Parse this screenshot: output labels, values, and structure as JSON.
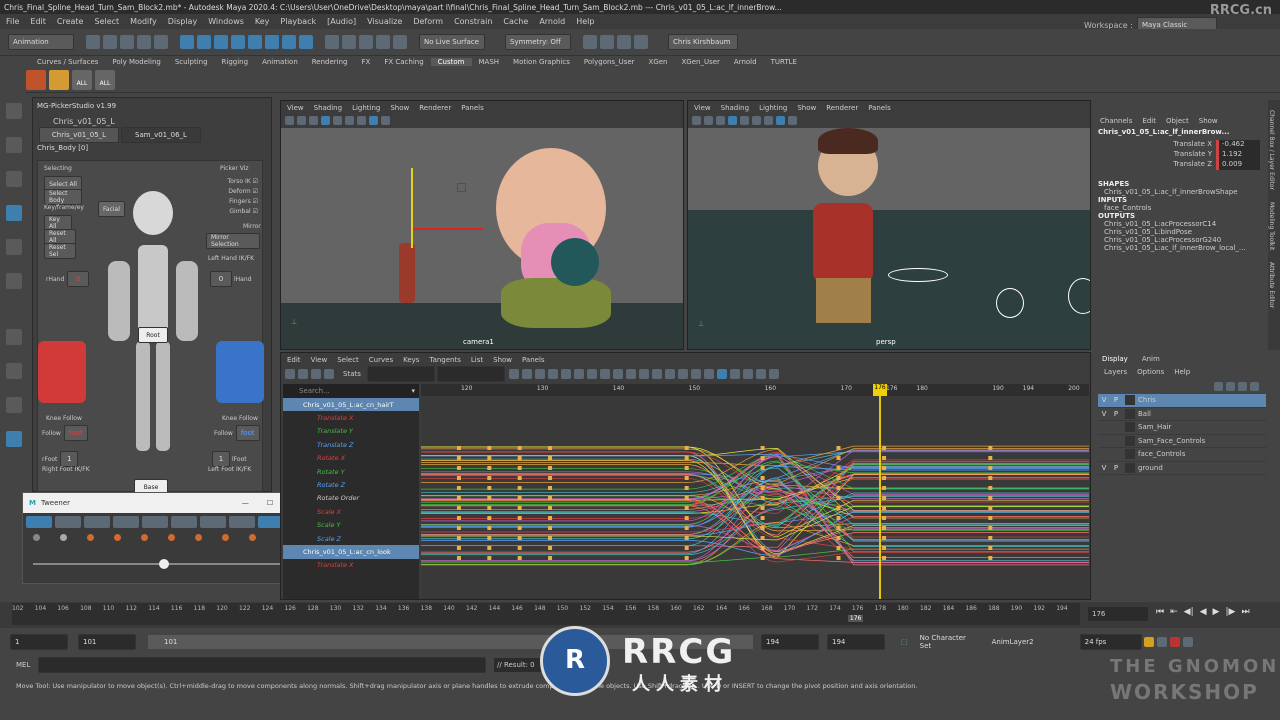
{
  "title_bar": "Chris_Final_Spline_Head_Turn_Sam_Block2.mb* - Autodesk Maya 2020.4: C:\\Users\\User\\OneDrive\\Desktop\\maya\\part I\\final\\Chris_Final_Spline_Head_Turn_Sam_Block2.mb  ---  Chris_v01_05_L:ac_lf_innerBrow...",
  "menu": [
    "File",
    "Edit",
    "Create",
    "Select",
    "Modify",
    "Display",
    "Windows",
    "Key",
    "Playback",
    "[Audio]",
    "Visualize",
    "Deform",
    "Constrain",
    "Cache",
    "Arnold",
    "Help"
  ],
  "workspace_label": "Workspace :",
  "workspace_value": "Maya Classic",
  "menuset": "Animation",
  "no_live_surface": "No Live Surface",
  "symmetry": "Symmetry: Off",
  "user": "Chris Kirshbaum",
  "shelf_tabs": [
    "Curves / Surfaces",
    "Poly Modeling",
    "Sculpting",
    "Rigging",
    "Animation",
    "Rendering",
    "FX",
    "FX Caching",
    "Custom",
    "MASH",
    "Motion Graphics",
    "Polygons_User",
    "XGen",
    "XGen_User",
    "Arnold",
    "TURTLE"
  ],
  "shelf_active": "Custom",
  "shelf_icons": [
    "ALL",
    "ALL"
  ],
  "picker": {
    "title": "MG-PickerStudio v1.99",
    "char_dropdown": "Chris_v01_05_L",
    "tab1": "Chris_v01_05_L",
    "tab2": "Sam_v01_06_L",
    "sub": "Chris_Body [0]",
    "selecting": "Selecting",
    "select_all": "Select All",
    "select_body": "Select Body",
    "keyframe": "Key/frame/ey",
    "key_all": "Key All",
    "reset_all": "Reset All",
    "reset_sel": "Reset Sel",
    "picker_viz": "Picker Viz",
    "torso": "Torso IK",
    "deform": "Deform",
    "fingers": "Fingers",
    "gimbal": "Gimbal",
    "mirror": "Mirror",
    "mirror_selection": "Mirror Selection",
    "facial": "Facial",
    "root": "Root",
    "lhand": "Left Hand IK/FK",
    "rhand": "rHand",
    "hand_val": "0",
    "lhand_lbl": "lHand",
    "knee_follow_l": "Knee Follow",
    "knee_follow_r": "Knee Follow",
    "follow": "Follow",
    "foot": "foot",
    "rfoot": "rFoot",
    "lfoot": "lFoot",
    "rfoot_lbl": "Right Foot IK/FK",
    "lfoot_lbl": "Left Foot IK/FK",
    "one": "1",
    "base": "Base"
  },
  "tweener": {
    "title": "Tweener"
  },
  "viewport_menu": [
    "View",
    "Shading",
    "Lighting",
    "Show",
    "Renderer",
    "Panels"
  ],
  "cam1": "camera1",
  "cam2": "persp",
  "graph": {
    "menu": [
      "Edit",
      "View",
      "Select",
      "Curves",
      "Keys",
      "Tangents",
      "List",
      "Show",
      "Panels"
    ],
    "stats": "Stats",
    "search": "Search...",
    "ruler": [
      "120",
      "130",
      "140",
      "150",
      "160",
      "170",
      "176",
      "180",
      "190",
      "194",
      "200"
    ],
    "outliner": [
      {
        "t": "Chris_v01_05_L:ac_cn_hairT",
        "c": "#fff",
        "sel": true
      },
      {
        "t": "Translate X",
        "c": "#e04040"
      },
      {
        "t": "Translate Y",
        "c": "#40c040"
      },
      {
        "t": "Translate Z",
        "c": "#5aa0ff"
      },
      {
        "t": "Rotate X",
        "c": "#e04040"
      },
      {
        "t": "Rotate Y",
        "c": "#40c040"
      },
      {
        "t": "Rotate Z",
        "c": "#5aa0ff"
      },
      {
        "t": "Rotate Order",
        "c": "#ccc"
      },
      {
        "t": "Scale X",
        "c": "#e04040"
      },
      {
        "t": "Scale Y",
        "c": "#40c040"
      },
      {
        "t": "Scale Z",
        "c": "#5aa0ff"
      },
      {
        "t": "Chris_v01_05_L:ac_cn_look",
        "c": "#fff",
        "sel": true
      },
      {
        "t": "Translate X",
        "c": "#e04040"
      }
    ]
  },
  "channel_box": {
    "menu": [
      "Channels",
      "Edit",
      "Object",
      "Show"
    ],
    "node": "Chris_v01_05_L:ac_lf_innerBrow...",
    "attrs": [
      {
        "n": "Translate X",
        "v": "-0.462"
      },
      {
        "n": "Translate Y",
        "v": "1.192"
      },
      {
        "n": "Translate Z",
        "v": "0.009"
      }
    ],
    "shapes_h": "SHAPES",
    "shape": "Chris_v01_05_L:ac_lf_innerBrowShape",
    "inputs_h": "INPUTS",
    "input": "face_Controls",
    "outputs_h": "OUTPUTS",
    "outputs": [
      "Chris_v01_05_L:acProcessorC14",
      "Chris_v01_05_L:bindPose",
      "Chris_v01_05_L:acProcessorG240",
      "Chris_v01_05_L:ac_lf_innerBrow_local_..."
    ],
    "side_tabs": [
      "Channel Box / Layer Editor",
      "Modeling Toolkit",
      "Attribute Editor"
    ]
  },
  "layers": {
    "tabs": [
      "Display",
      "Anim"
    ],
    "menu": [
      "Layers",
      "Options",
      "Help"
    ],
    "rows": [
      {
        "v": "V",
        "p": "P",
        "n": "Chris",
        "sel": true
      },
      {
        "v": "V",
        "p": "P",
        "n": "Ball"
      },
      {
        "v": "",
        "p": "",
        "n": "Sam_Hair"
      },
      {
        "v": "",
        "p": "",
        "n": "Sam_Face_Controls"
      },
      {
        "v": "",
        "p": "",
        "n": "face_Controls"
      },
      {
        "v": "V",
        "p": "P",
        "n": "ground"
      }
    ]
  },
  "timeline": {
    "ticks": [
      "102",
      "104",
      "106",
      "108",
      "110",
      "112",
      "114",
      "116",
      "118",
      "120",
      "122",
      "124",
      "126",
      "128",
      "130",
      "132",
      "134",
      "136",
      "138",
      "140",
      "142",
      "144",
      "146",
      "148",
      "150",
      "152",
      "154",
      "156",
      "158",
      "160",
      "162",
      "164",
      "166",
      "168",
      "170",
      "172",
      "174",
      "176",
      "178",
      "180",
      "182",
      "184",
      "186",
      "188",
      "190",
      "192",
      "194"
    ],
    "current": "176",
    "current_box": "176"
  },
  "range": {
    "start": "1",
    "inner_start": "101",
    "slider_label": "101",
    "inner_end": "194",
    "end": "194",
    "char_set": "No Character Set",
    "anim_layer": "AnimLayer2",
    "fps": "24 fps"
  },
  "cmd": {
    "lang": "MEL",
    "result": "// Result: 0"
  },
  "help_line": "Move Tool: Use manipulator to move object(s). Ctrl+middle-drag to move components along normals. Shift+drag manipulator axis or plane handles to extrude components or clone objects. Use Shift+drag to ... Use D or INSERT to change the pivot position and axis orientation.",
  "watermark": {
    "rrcg": "RRCG",
    "sub": "人人素材",
    "corner": "RRCG.cn",
    "gnomon1": "THE GNOMON",
    "gnomon2": "WORKSHOP"
  }
}
